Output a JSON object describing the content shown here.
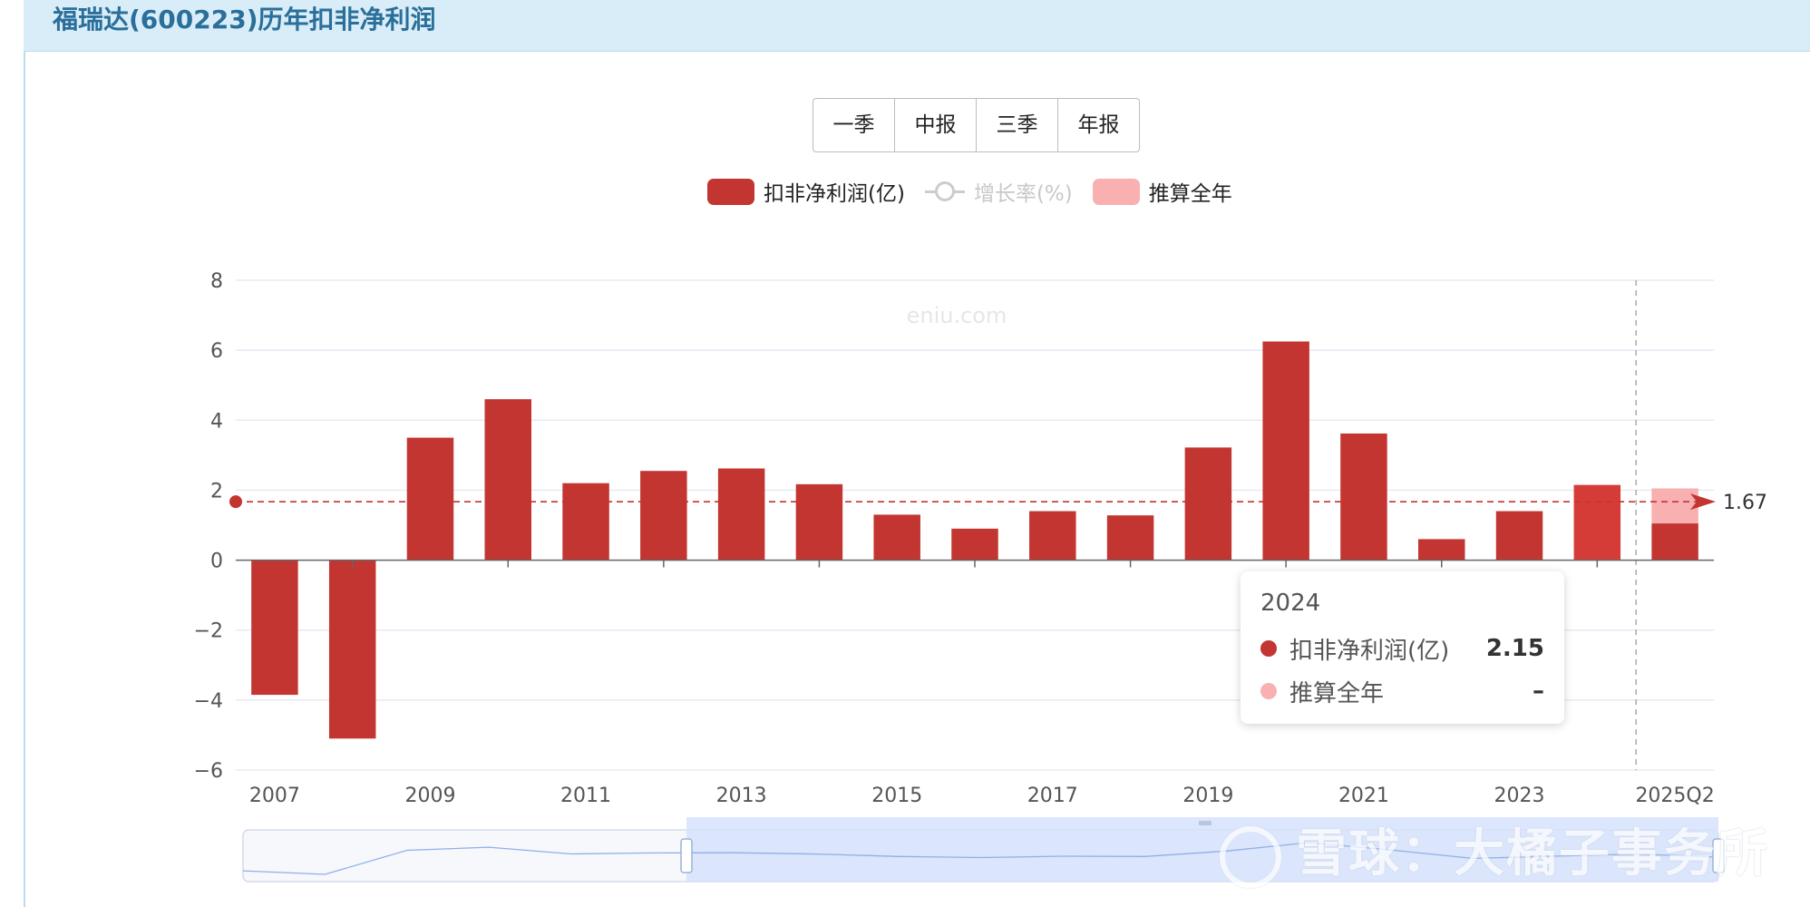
{
  "header": {
    "title": "福瑞达(600223)历年扣非净利润"
  },
  "tabs": [
    {
      "label": "一季"
    },
    {
      "label": "中报"
    },
    {
      "label": "三季"
    },
    {
      "label": "年报"
    }
  ],
  "legend": [
    {
      "label": "扣非净利润(亿)",
      "color": "#c23531",
      "active": true
    },
    {
      "label": "增长率(%)",
      "color": "#cccccc",
      "active": false
    },
    {
      "label": "推算全年",
      "color": "#f8b0b0",
      "active": true
    }
  ],
  "site_watermark": "eniu.com",
  "tooltip": {
    "title": "2024",
    "rows": [
      {
        "name": "扣非净利润(亿)",
        "value": "2.15",
        "color": "#c23531"
      },
      {
        "name": "推算全年",
        "value": "–",
        "color": "#f8b0b0"
      }
    ]
  },
  "watermark": "雪球：大橘子事务所",
  "chart_data": {
    "type": "bar",
    "categories": [
      "2007",
      "2008",
      "2009",
      "2010",
      "2011",
      "2012",
      "2013",
      "2014",
      "2015",
      "2016",
      "2017",
      "2018",
      "2019",
      "2020",
      "2021",
      "2022",
      "2023",
      "2024",
      "2025Q2"
    ],
    "x_tick_labels": [
      "2007",
      "2009",
      "2011",
      "2013",
      "2015",
      "2017",
      "2019",
      "2021",
      "2023",
      "2025Q2"
    ],
    "series": [
      {
        "name": "扣非净利润(亿)",
        "color": "#c23531",
        "values": [
          -3.85,
          -5.1,
          3.5,
          4.6,
          2.2,
          2.55,
          2.62,
          2.17,
          1.3,
          0.9,
          1.4,
          1.28,
          3.22,
          6.25,
          3.62,
          0.6,
          1.4,
          2.15,
          1.05
        ]
      },
      {
        "name": "推算全年",
        "color": "#f8b0b0",
        "values": [
          null,
          null,
          null,
          null,
          null,
          null,
          null,
          null,
          null,
          null,
          null,
          null,
          null,
          null,
          null,
          null,
          null,
          null,
          2.05
        ]
      }
    ],
    "ylim": [
      -6,
      8
    ],
    "yticks": [
      -6,
      -4,
      -2,
      0,
      2,
      4,
      6,
      8
    ],
    "y_tick_labels": [
      "−6",
      "−4",
      "−2",
      "0",
      "2",
      "4",
      "6",
      "8"
    ],
    "grid": true,
    "average_line": {
      "value": 1.67,
      "label": "1.67"
    },
    "highlight_category": "2024"
  }
}
